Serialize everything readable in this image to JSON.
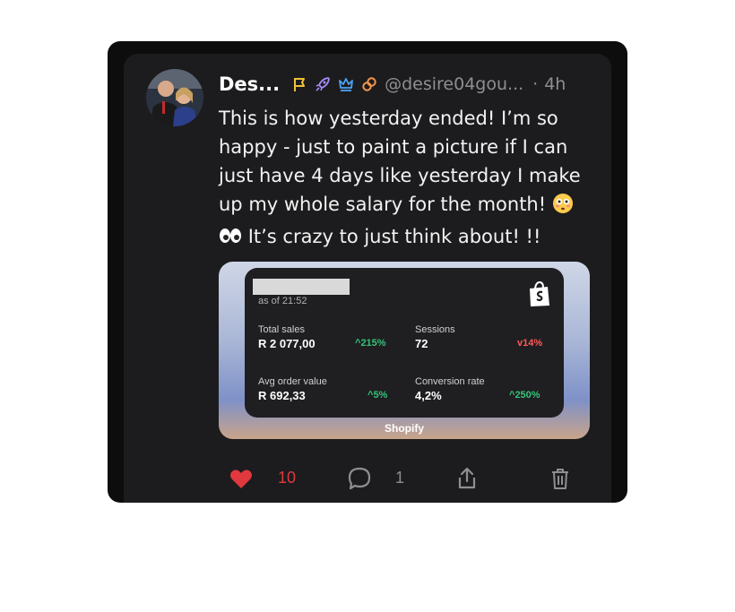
{
  "post": {
    "author_name": "Des...",
    "handle": "@desire04gou...",
    "separator": "·",
    "time": "4h",
    "badges": [
      "flag-icon",
      "rocket-icon",
      "crown-icon",
      "link-icon"
    ],
    "text_lines": [
      "This is how yesterday ended! I’m so",
      "happy - just to paint a picture if I can",
      "just have 4 days like yesterday I make",
      "up my whole salary for the month!",
      "It’s crazy to just think about!  !!"
    ],
    "emojis": [
      "flushed-face-emoji",
      "eyes-emoji"
    ]
  },
  "attachment": {
    "as_of": "as of 21:52",
    "metrics": [
      {
        "label": "Total sales",
        "value": "R 2 077,00",
        "change": "215%",
        "direction": "up"
      },
      {
        "label": "Sessions",
        "value": "72",
        "change": "14%",
        "direction": "down"
      },
      {
        "label": "Avg order value",
        "value": "R 692,33",
        "change": "5%",
        "direction": "up"
      },
      {
        "label": "Conversion rate",
        "value": "4,2%",
        "change": "250%",
        "direction": "up"
      }
    ],
    "app_label": "Shopify"
  },
  "actions": {
    "like_count": "10",
    "reply_count": "1",
    "like_color": "#e0383e"
  }
}
